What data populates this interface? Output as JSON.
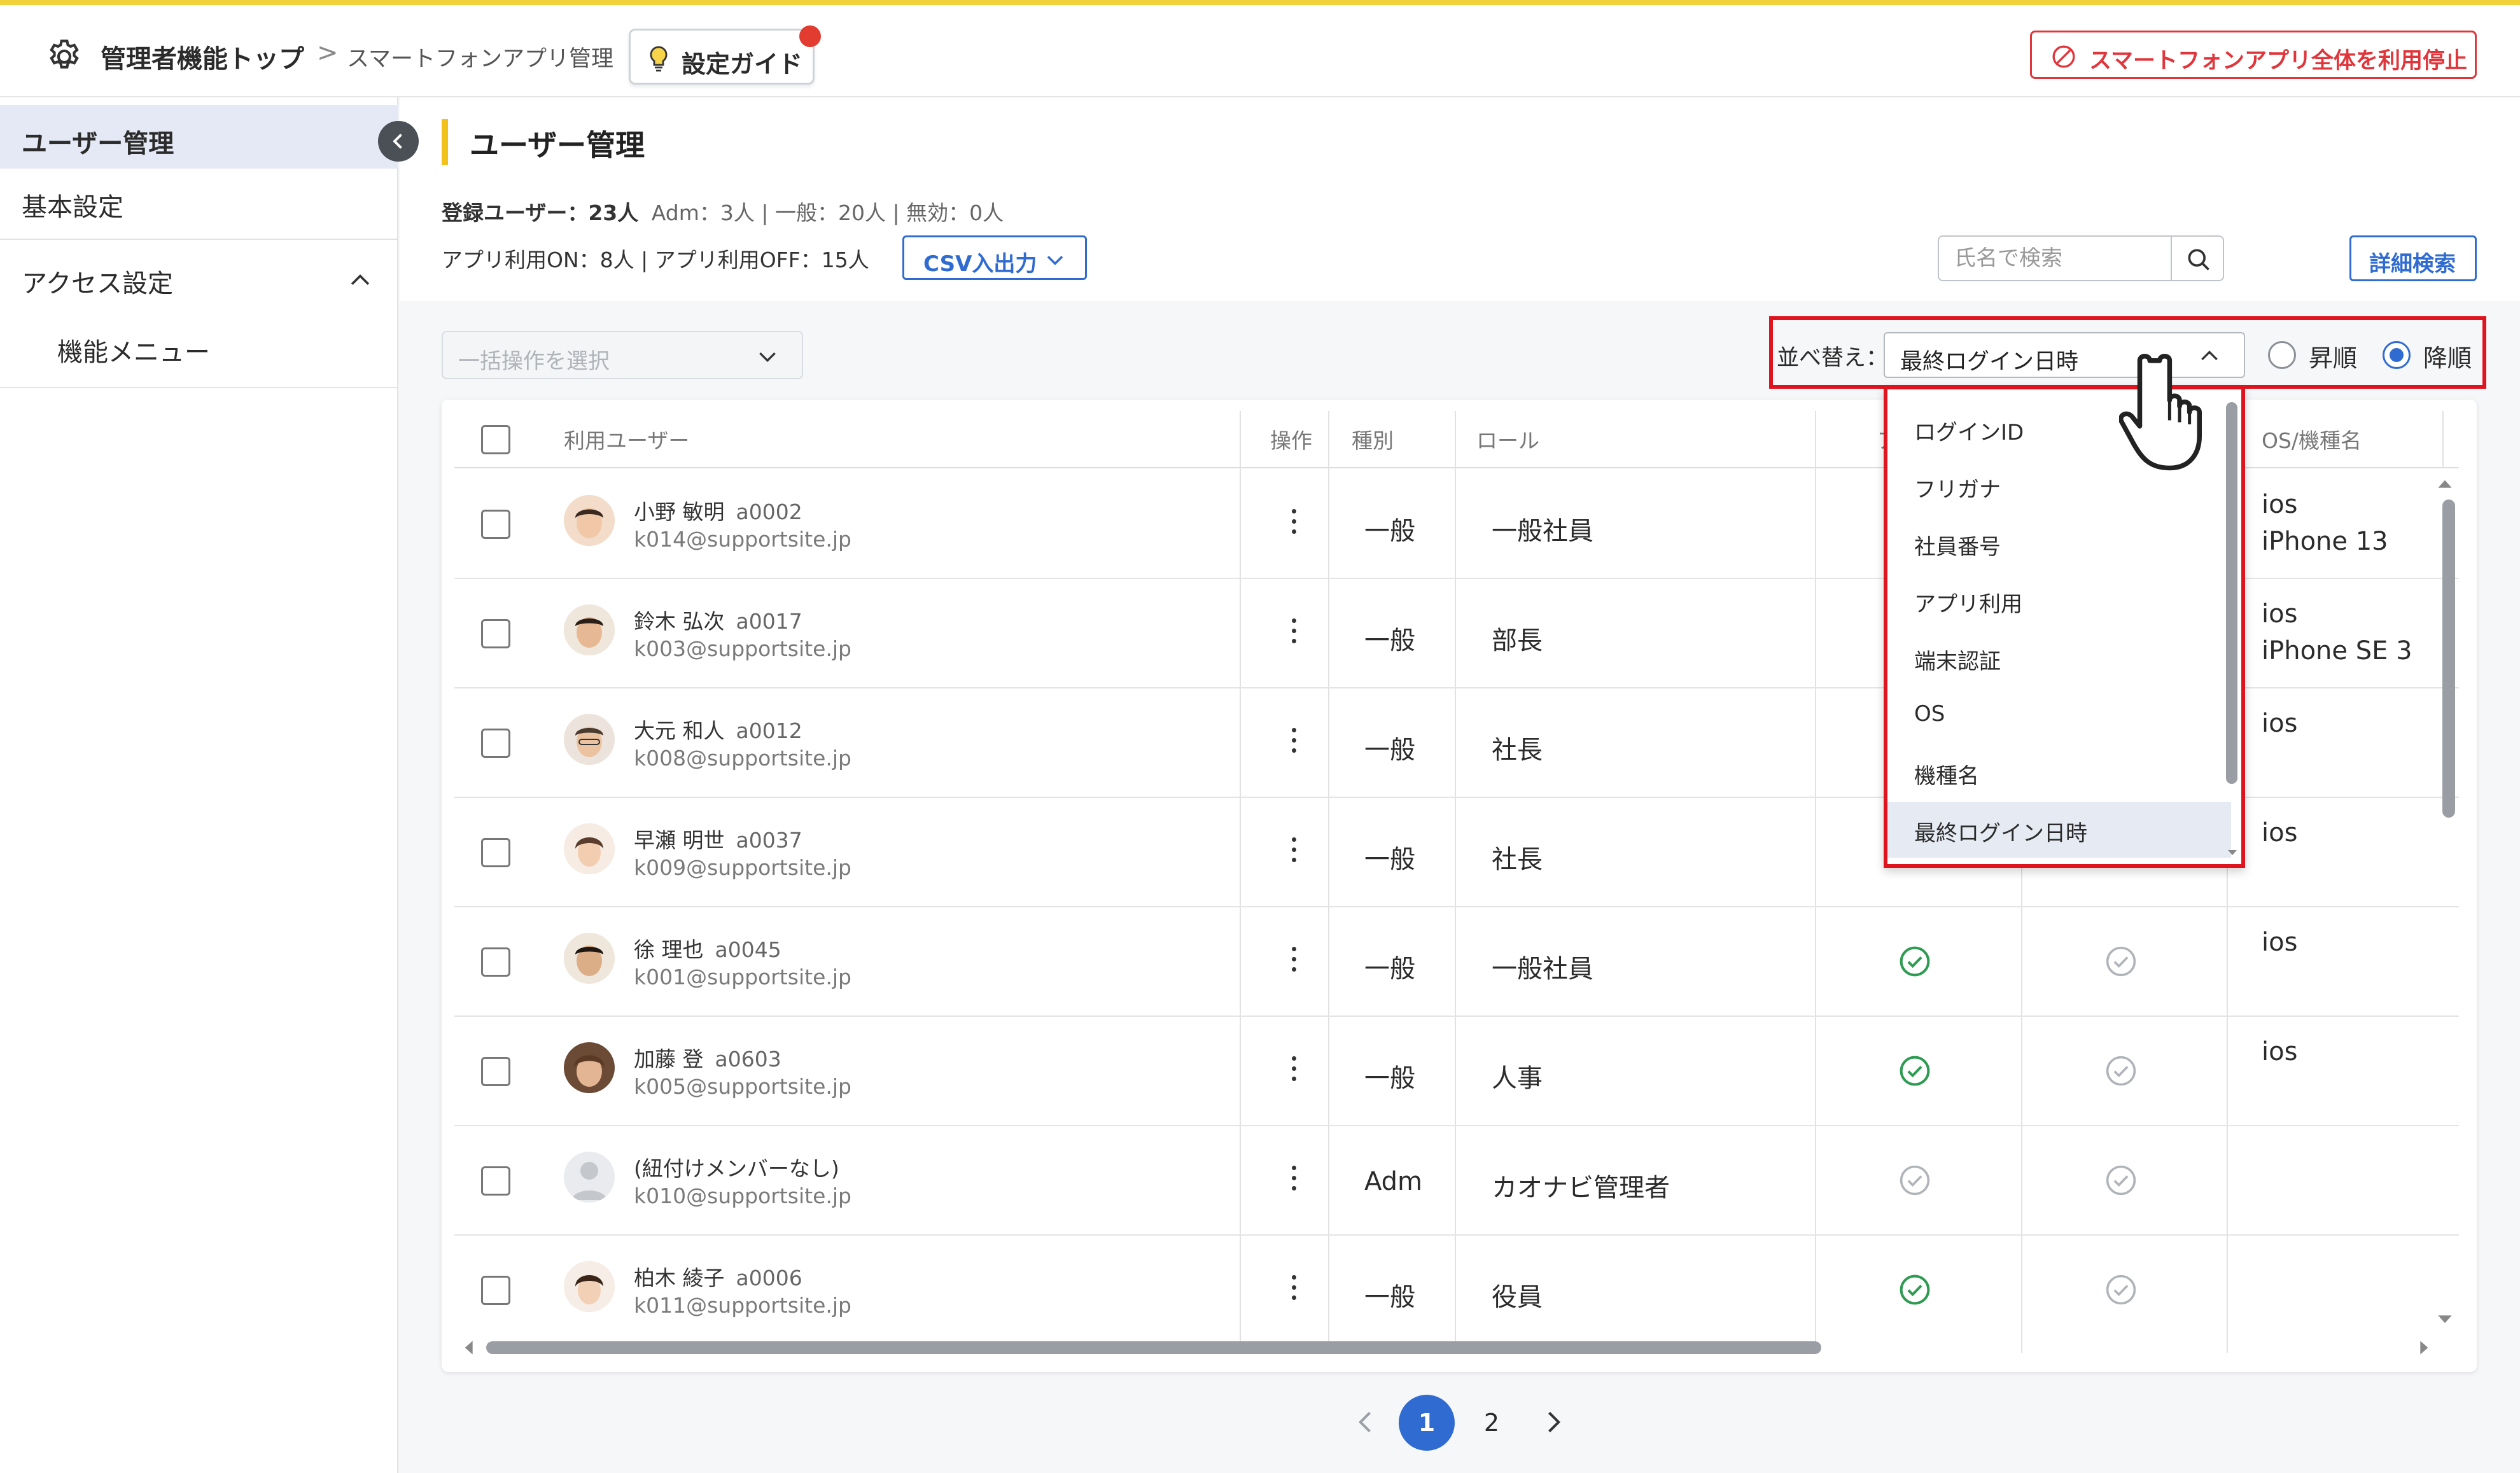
{
  "header": {
    "top_label": "管理者機能トップ",
    "crumb_separator": ">",
    "crumb": "スマートフォンアプリ管理",
    "guide_label": "設定ガイド",
    "stop_label": "スマートフォンアプリ全体を利用停止"
  },
  "sidebar": {
    "items": [
      {
        "label": "ユーザー管理"
      },
      {
        "label": "基本設定"
      },
      {
        "label": "アクセス設定"
      },
      {
        "label": "機能メニュー"
      }
    ]
  },
  "page": {
    "title": "ユーザー管理",
    "stats": {
      "registered": "登録ユーザー：23人",
      "adm": "Adm：3人",
      "general": "一般：20人",
      "invalid": "無効：0人",
      "separator": "|",
      "app_on": "アプリ利用ON：8人",
      "app_off": "アプリ利用OFF：15人"
    },
    "csv_label": "CSV入出力",
    "search_placeholder": "氏名で検索",
    "advanced_label": "詳細検索",
    "bulk_placeholder": "一括操作を選択"
  },
  "sort": {
    "label": "並べ替え：",
    "selected": "最終ログイン日時",
    "asc_label": "昇順",
    "desc_label": "降順",
    "order": "desc",
    "options": [
      "ログインID",
      "フリガナ",
      "社員番号",
      "アプリ利用",
      "端末認証",
      "OS",
      "機種名",
      "最終ログイン日時"
    ]
  },
  "table": {
    "headers": {
      "user": "利用ユーザー",
      "action": "操作",
      "type": "種別",
      "role": "ロール",
      "app_partial": "ア",
      "os": "OS/機種名"
    },
    "rows": [
      {
        "name": "小野 敏明",
        "code": "a0002",
        "email": "k014@supportsite.jp",
        "type": "一般",
        "role": "一般社員",
        "os": "ios",
        "model": "iPhone 13",
        "app": null,
        "auth": null
      },
      {
        "name": "鈴木 弘次",
        "code": "a0017",
        "email": "k003@supportsite.jp",
        "type": "一般",
        "role": "部長",
        "os": "ios",
        "model": "iPhone SE 3",
        "app": null,
        "auth": null
      },
      {
        "name": "大元 和人",
        "code": "a0012",
        "email": "k008@supportsite.jp",
        "type": "一般",
        "role": "社長",
        "os": "ios",
        "model": "",
        "app": null,
        "auth": null
      },
      {
        "name": "早瀬 明世",
        "code": "a0037",
        "email": "k009@supportsite.jp",
        "type": "一般",
        "role": "社長",
        "os": "ios",
        "model": "",
        "app": null,
        "auth": null
      },
      {
        "name": "徐 理也",
        "code": "a0045",
        "email": "k001@supportsite.jp",
        "type": "一般",
        "role": "一般社員",
        "os": "ios",
        "model": "",
        "app": "on",
        "auth": "off"
      },
      {
        "name": "加藤 登",
        "code": "a0603",
        "email": "k005@supportsite.jp",
        "type": "一般",
        "role": "人事",
        "os": "ios",
        "model": "",
        "app": "on",
        "auth": "off"
      },
      {
        "name": "(紐付けメンバーなし)",
        "code": "",
        "email": "k010@supportsite.jp",
        "type": "Adm",
        "role": "カオナビ管理者",
        "os": "",
        "model": "",
        "app": "off",
        "auth": "off"
      },
      {
        "name": "柏木 綾子",
        "code": "a0006",
        "email": "k011@supportsite.jp",
        "type": "一般",
        "role": "役員",
        "os": "",
        "model": "",
        "app": "on",
        "auth": "off"
      }
    ]
  },
  "pagination": {
    "pages": [
      "1",
      "2"
    ],
    "current": "1"
  },
  "colors": {
    "accent": "#2f6bd0",
    "danger": "#e0363b",
    "highlight": "#e0141e",
    "title_bar": "#f2c21b",
    "check_on": "#2e9b52",
    "check_off": "#b0b4b9"
  },
  "icons": [
    "gear-icon",
    "bulb-icon",
    "ban-icon",
    "chevron-left-icon",
    "chevron-up-icon",
    "chevron-down-icon",
    "search-icon",
    "kebab-icon",
    "check-circle-icon",
    "hand-pointer-icon"
  ]
}
